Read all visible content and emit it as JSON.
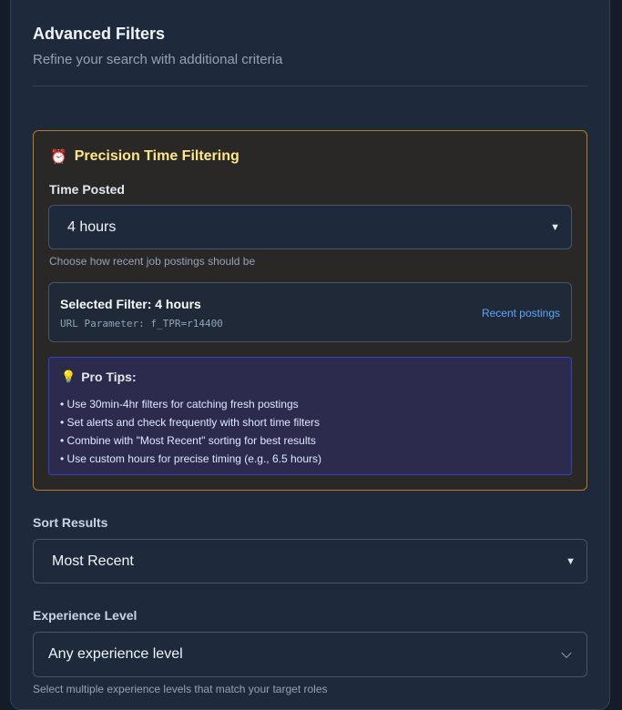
{
  "header": {
    "title": "Advanced Filters",
    "subtitle": "Refine your search with additional criteria"
  },
  "precision": {
    "icon": "alarm-clock-icon",
    "title": "Precision Time Filtering",
    "time_label": "Time Posted",
    "time_value": "4 hours",
    "time_help": "Choose how recent job postings should be",
    "selected_filter": "Selected Filter: 4 hours",
    "url_param": "URL Parameter: f_TPR=r14400",
    "link": "Recent postings"
  },
  "tips": {
    "icon": "lightbulb-icon",
    "title": "Pro Tips:",
    "items": [
      "• Use 30min-4hr filters for catching fresh postings",
      "• Set alerts and check frequently with short time filters",
      "• Combine with \"Most Recent\" sorting for best results",
      "• Use custom hours for precise timing (e.g., 6.5 hours)"
    ]
  },
  "sort": {
    "label": "Sort Results",
    "value": "Most Recent"
  },
  "experience": {
    "label": "Experience Level",
    "value": "Any experience level",
    "help": "Select multiple experience levels that match your target roles"
  },
  "colors": {
    "panel_bg": "#1e293b",
    "precision_border": "#b97b1b",
    "precision_title": "#fde68a",
    "tips_border": "#2f42c8",
    "link": "#60a5fa"
  }
}
